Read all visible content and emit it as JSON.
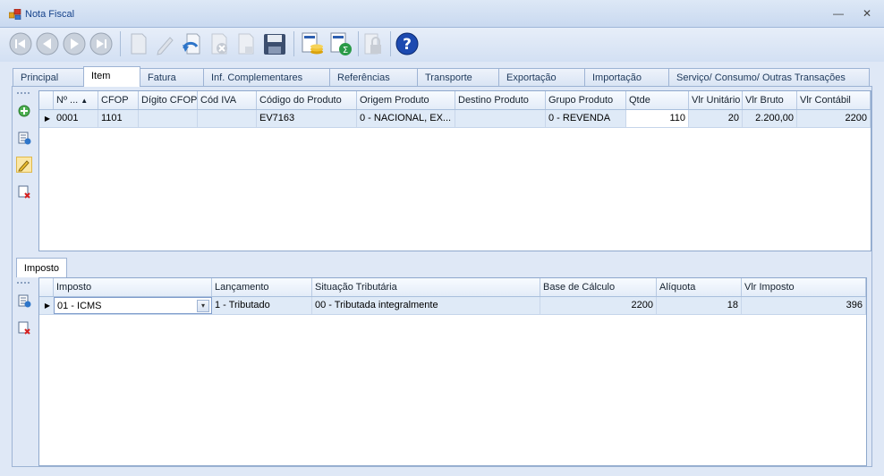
{
  "window": {
    "title": "Nota Fiscal",
    "minimize": "—",
    "close": "✕"
  },
  "tabs": [
    {
      "label": "Principal"
    },
    {
      "label": "Item"
    },
    {
      "label": "Fatura"
    },
    {
      "label": "Inf. Complementares"
    },
    {
      "label": "Referências"
    },
    {
      "label": "Transporte"
    },
    {
      "label": "Exportação"
    },
    {
      "label": "Importação"
    },
    {
      "label": "Serviço/ Consumo/ Outras Transações"
    }
  ],
  "items_grid": {
    "columns": [
      "Nº ...",
      "CFOP",
      "Dígito CFOP",
      "Cód IVA",
      "Código do Produto",
      "Origem Produto",
      "Destino Produto",
      "Grupo Produto",
      "Qtde",
      "Vlr Unitário",
      "Vlr Bruto",
      "Vlr Contábil"
    ],
    "sort_indicator": "▲",
    "rows": [
      [
        "0001",
        "1101",
        "",
        "",
        "EV7163",
        "0 - NACIONAL, EX...",
        "",
        "0 - REVENDA",
        "110",
        "20",
        "2.200,00",
        "2200"
      ]
    ]
  },
  "subtab": {
    "label": "Imposto"
  },
  "tax_grid": {
    "columns": [
      "Imposto",
      "Lançamento",
      "Situação Tributária",
      "Base de Cálculo",
      "Alíquota",
      "Vlr Imposto"
    ],
    "rows": [
      [
        "01 - ICMS",
        "1 - Tributado",
        "00 - Tributada integralmente",
        "2200",
        "18",
        "396"
      ]
    ]
  },
  "row_marker": "▶",
  "dropdown_arrow": "▾"
}
